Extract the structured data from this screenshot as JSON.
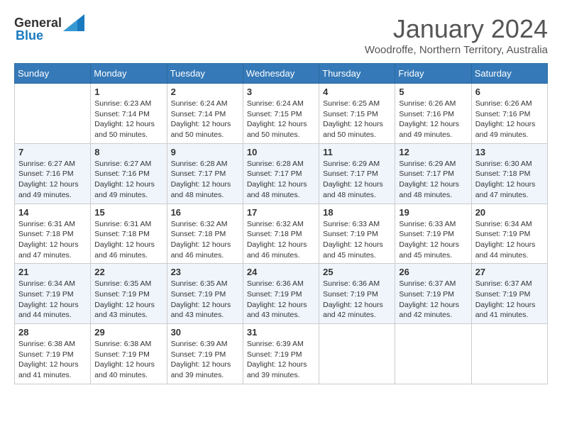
{
  "header": {
    "logo_general": "General",
    "logo_blue": "Blue",
    "month_year": "January 2024",
    "location": "Woodroffe, Northern Territory, Australia"
  },
  "days_of_week": [
    "Sunday",
    "Monday",
    "Tuesday",
    "Wednesday",
    "Thursday",
    "Friday",
    "Saturday"
  ],
  "weeks": [
    [
      {
        "day": "",
        "sunrise": "",
        "sunset": "",
        "daylight": ""
      },
      {
        "day": "1",
        "sunrise": "6:23 AM",
        "sunset": "7:14 PM",
        "daylight": "12 hours and 50 minutes."
      },
      {
        "day": "2",
        "sunrise": "6:24 AM",
        "sunset": "7:14 PM",
        "daylight": "12 hours and 50 minutes."
      },
      {
        "day": "3",
        "sunrise": "6:24 AM",
        "sunset": "7:15 PM",
        "daylight": "12 hours and 50 minutes."
      },
      {
        "day": "4",
        "sunrise": "6:25 AM",
        "sunset": "7:15 PM",
        "daylight": "12 hours and 50 minutes."
      },
      {
        "day": "5",
        "sunrise": "6:26 AM",
        "sunset": "7:16 PM",
        "daylight": "12 hours and 49 minutes."
      },
      {
        "day": "6",
        "sunrise": "6:26 AM",
        "sunset": "7:16 PM",
        "daylight": "12 hours and 49 minutes."
      }
    ],
    [
      {
        "day": "7",
        "sunrise": "6:27 AM",
        "sunset": "7:16 PM",
        "daylight": "12 hours and 49 minutes."
      },
      {
        "day": "8",
        "sunrise": "6:27 AM",
        "sunset": "7:16 PM",
        "daylight": "12 hours and 49 minutes."
      },
      {
        "day": "9",
        "sunrise": "6:28 AM",
        "sunset": "7:17 PM",
        "daylight": "12 hours and 48 minutes."
      },
      {
        "day": "10",
        "sunrise": "6:28 AM",
        "sunset": "7:17 PM",
        "daylight": "12 hours and 48 minutes."
      },
      {
        "day": "11",
        "sunrise": "6:29 AM",
        "sunset": "7:17 PM",
        "daylight": "12 hours and 48 minutes."
      },
      {
        "day": "12",
        "sunrise": "6:29 AM",
        "sunset": "7:17 PM",
        "daylight": "12 hours and 48 minutes."
      },
      {
        "day": "13",
        "sunrise": "6:30 AM",
        "sunset": "7:18 PM",
        "daylight": "12 hours and 47 minutes."
      }
    ],
    [
      {
        "day": "14",
        "sunrise": "6:31 AM",
        "sunset": "7:18 PM",
        "daylight": "12 hours and 47 minutes."
      },
      {
        "day": "15",
        "sunrise": "6:31 AM",
        "sunset": "7:18 PM",
        "daylight": "12 hours and 46 minutes."
      },
      {
        "day": "16",
        "sunrise": "6:32 AM",
        "sunset": "7:18 PM",
        "daylight": "12 hours and 46 minutes."
      },
      {
        "day": "17",
        "sunrise": "6:32 AM",
        "sunset": "7:18 PM",
        "daylight": "12 hours and 46 minutes."
      },
      {
        "day": "18",
        "sunrise": "6:33 AM",
        "sunset": "7:19 PM",
        "daylight": "12 hours and 45 minutes."
      },
      {
        "day": "19",
        "sunrise": "6:33 AM",
        "sunset": "7:19 PM",
        "daylight": "12 hours and 45 minutes."
      },
      {
        "day": "20",
        "sunrise": "6:34 AM",
        "sunset": "7:19 PM",
        "daylight": "12 hours and 44 minutes."
      }
    ],
    [
      {
        "day": "21",
        "sunrise": "6:34 AM",
        "sunset": "7:19 PM",
        "daylight": "12 hours and 44 minutes."
      },
      {
        "day": "22",
        "sunrise": "6:35 AM",
        "sunset": "7:19 PM",
        "daylight": "12 hours and 43 minutes."
      },
      {
        "day": "23",
        "sunrise": "6:35 AM",
        "sunset": "7:19 PM",
        "daylight": "12 hours and 43 minutes."
      },
      {
        "day": "24",
        "sunrise": "6:36 AM",
        "sunset": "7:19 PM",
        "daylight": "12 hours and 43 minutes."
      },
      {
        "day": "25",
        "sunrise": "6:36 AM",
        "sunset": "7:19 PM",
        "daylight": "12 hours and 42 minutes."
      },
      {
        "day": "26",
        "sunrise": "6:37 AM",
        "sunset": "7:19 PM",
        "daylight": "12 hours and 42 minutes."
      },
      {
        "day": "27",
        "sunrise": "6:37 AM",
        "sunset": "7:19 PM",
        "daylight": "12 hours and 41 minutes."
      }
    ],
    [
      {
        "day": "28",
        "sunrise": "6:38 AM",
        "sunset": "7:19 PM",
        "daylight": "12 hours and 41 minutes."
      },
      {
        "day": "29",
        "sunrise": "6:38 AM",
        "sunset": "7:19 PM",
        "daylight": "12 hours and 40 minutes."
      },
      {
        "day": "30",
        "sunrise": "6:39 AM",
        "sunset": "7:19 PM",
        "daylight": "12 hours and 39 minutes."
      },
      {
        "day": "31",
        "sunrise": "6:39 AM",
        "sunset": "7:19 PM",
        "daylight": "12 hours and 39 minutes."
      },
      {
        "day": "",
        "sunrise": "",
        "sunset": "",
        "daylight": ""
      },
      {
        "day": "",
        "sunrise": "",
        "sunset": "",
        "daylight": ""
      },
      {
        "day": "",
        "sunrise": "",
        "sunset": "",
        "daylight": ""
      }
    ]
  ],
  "labels": {
    "sunrise": "Sunrise:",
    "sunset": "Sunset:",
    "daylight": "Daylight:"
  }
}
